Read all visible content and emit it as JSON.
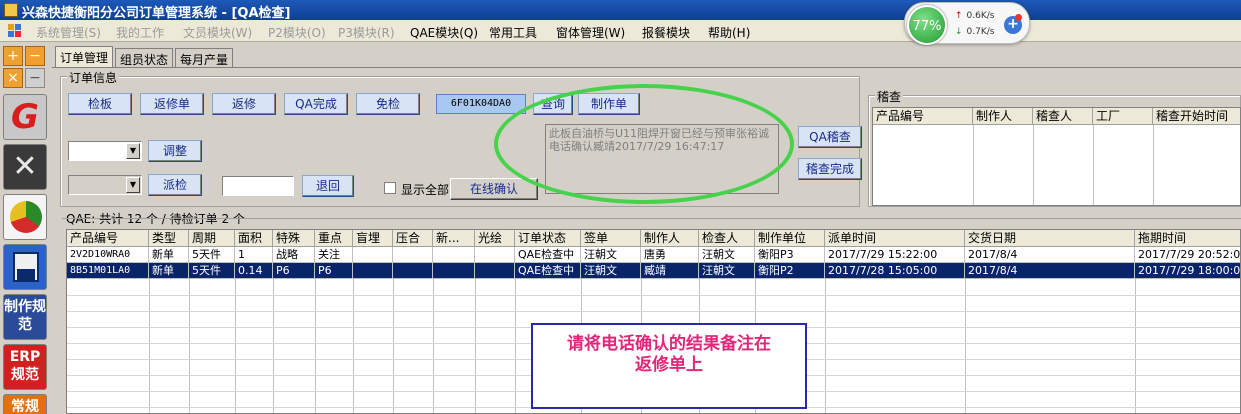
{
  "window": {
    "title": "兴森快捷衡阳分公司订单管理系统 - [QA检查]"
  },
  "menu": [
    {
      "label": "系统管理(S)",
      "enabled": false
    },
    {
      "label": "我的工作",
      "enabled": false
    },
    {
      "label": "文员模块(W)",
      "enabled": false
    },
    {
      "label": "P2模块(O)",
      "enabled": false
    },
    {
      "label": "P3模块(R)",
      "enabled": false
    },
    {
      "label": "QAE模块(Q)",
      "enabled": true
    },
    {
      "label": "常用工具",
      "enabled": true
    },
    {
      "label": "窗体管理(W)",
      "enabled": true
    },
    {
      "label": "报餐模块",
      "enabled": true
    },
    {
      "label": "帮助(H)",
      "enabled": true
    }
  ],
  "network": {
    "percent": "77%",
    "up": "0.6K/s",
    "down": "0.7K/s"
  },
  "left_toolbar": {
    "make_spec": "制作规范",
    "erp_spec": "ERP规范",
    "normal": "常规"
  },
  "tabs": [
    "订单管理",
    "组员状态",
    "每月产量"
  ],
  "order_info": {
    "label": "订单信息",
    "buttons": [
      "检板",
      "返修单",
      "返修",
      "QA完成",
      "免检"
    ],
    "code": "6F01K04DA0",
    "query": "查询",
    "make_order": "制作单",
    "adjust": "调整",
    "dispatch": "派检",
    "back": "退回",
    "show_all": "显示全部",
    "online_confirm": "在线确认",
    "memo_text": "此板自油桥与U11阻焊开窗已经与预审张裕诚电话确认臧靖2017/7/29 16:47:17",
    "qa_recheck": "QA稽查",
    "recheck_done": "稽查完成"
  },
  "recheck": {
    "label": "稽查",
    "columns": [
      "产品编号",
      "制作人",
      "稽查人",
      "工厂",
      "稽查开始时间"
    ]
  },
  "qae": {
    "summary": "QAE: 共计 12 个 / 待检订单 2 个",
    "columns": [
      "产品编号",
      "类型",
      "周期",
      "面积",
      "特殊",
      "重点",
      "盲埋",
      "压合",
      "新...",
      "光绘",
      "订单状态",
      "签单",
      "制作人",
      "检查人",
      "制作单位",
      "派单时间",
      "交货日期",
      "拖期时间"
    ],
    "rows": [
      [
        "2V2D10WRA0",
        "新单",
        "5天件",
        "1",
        "战略",
        "关注",
        "",
        "",
        "",
        "",
        "QAE检查中",
        "汪朝文",
        "唐勇",
        "汪朝文",
        "衡阳P3",
        "2017/7/29 15:22:00",
        "2017/8/4",
        "2017/7/29 20:52:0"
      ],
      [
        "8B51M01LA0",
        "新单",
        "5天件",
        "0.14",
        "P6",
        "P6",
        "",
        "",
        "",
        "",
        "QAE检查中",
        "汪朝文",
        "臧靖",
        "汪朝文",
        "衡阳P2",
        "2017/7/28 15:05:00",
        "2017/8/4",
        "2017/7/29 18:00:0"
      ]
    ]
  },
  "annotation": {
    "note_line1": "请将电话确认的结果备注在",
    "note_line2": "返修单上"
  }
}
